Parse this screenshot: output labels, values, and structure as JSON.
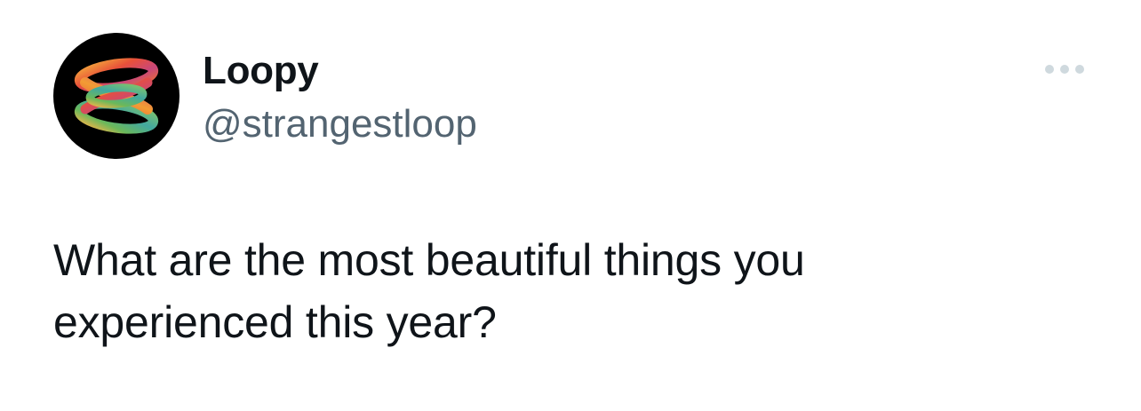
{
  "author": {
    "display_name": "Loopy",
    "handle": "@strangestloop"
  },
  "post": {
    "text_lines": [
      "What are the most beautiful things you",
      "experienced this year?"
    ]
  },
  "icons": {
    "avatar": "loop-knot-logo",
    "more": "more-horizontal-icon"
  },
  "colors": {
    "text_primary": "#0f1419",
    "text_secondary": "#536471",
    "more_icon": "#cfd9de",
    "avatar_bg": "#000000"
  }
}
